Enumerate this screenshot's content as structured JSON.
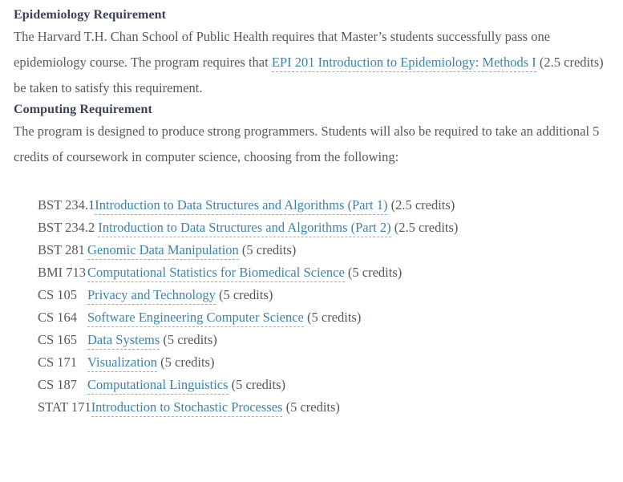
{
  "sections": [
    {
      "heading": "Epidemiology Requirement",
      "paragraph": {
        "before": "The Harvard T.H. Chan School of Public Health requires that Master’s students successfully pass one epidemiology course. The program requires that ",
        "link": "EPI 201 Introduction to Epidemiology: Methods I",
        "after": " (2.5 credits) be taken to satisfy this requirement."
      }
    },
    {
      "heading": "Computing Requirement",
      "paragraph": {
        "before": "The program is designed to produce strong programmers. Students will also be required to take an additional 5 credits of coursework in computer science, choosing from the following:",
        "link": "",
        "after": ""
      }
    }
  ],
  "course_list": [
    {
      "code": "BST 234.1",
      "title": "Introduction to Data Structures and Algorithms (Part 1)",
      "credits": "(2.5 credits)"
    },
    {
      "code": "BST 234.2",
      "title": "Introduction to Data Structures and Algorithms (Part 2)",
      "credits": "(2.5 credits)"
    },
    {
      "code": "BST 281",
      "title": "Genomic Data Manipulation",
      "credits": "(5 credits)"
    },
    {
      "code": "BMI 713",
      "title": "Computational Statistics for Biomedical Science",
      "credits": "(5 credits)"
    },
    {
      "code": "CS 105",
      "title": "Privacy and Technology",
      "credits": "(5 credits)"
    },
    {
      "code": "CS 164",
      "title": "Software Engineering Computer Science",
      "credits": "(5 credits)"
    },
    {
      "code": "CS 165",
      "title": "Data Systems",
      "credits": "(5 credits)"
    },
    {
      "code": "CS 171",
      "title": "Visualization",
      "credits": "(5 credits)"
    },
    {
      "code": "CS 187",
      "title": "Computational Linguistics",
      "credits": "(5 credits)"
    },
    {
      "code": "STAT 171",
      "title": "Introduction to Stochastic Processes",
      "credits": "(5 credits)"
    }
  ],
  "colors": {
    "link": "#3f82a8",
    "link_underline": "#86b4cd",
    "body_text": "#55585e",
    "heading_text": "#3c4352",
    "background": "#ffffff"
  }
}
